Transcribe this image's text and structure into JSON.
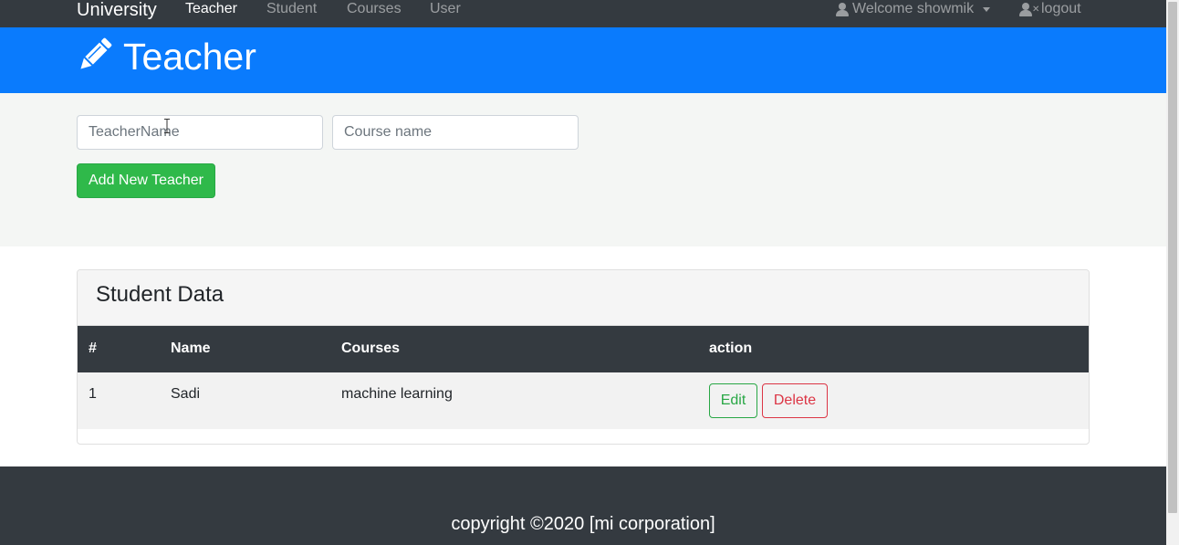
{
  "navbar": {
    "brand": "University",
    "links": [
      {
        "label": "Teacher",
        "active": true
      },
      {
        "label": "Student",
        "active": false
      },
      {
        "label": "Courses",
        "active": false
      },
      {
        "label": "User",
        "active": false
      }
    ],
    "welcome": "Welcome showmik",
    "logout": "logout"
  },
  "header": {
    "icon": "pencil-icon",
    "title": "Teacher"
  },
  "form": {
    "teacher_name_placeholder": "TeacherName",
    "course_name_placeholder": "Course name",
    "add_button": "Add New Teacher"
  },
  "table": {
    "title": "Student Data",
    "columns": [
      "#",
      "Name",
      "Courses",
      "action"
    ],
    "rows": [
      {
        "num": "1",
        "name": "Sadi",
        "course": "machine learning",
        "edit": "Edit",
        "delete": "Delete"
      }
    ]
  },
  "footer": {
    "text": "copyright ©2020 [mi corporation]"
  },
  "colors": {
    "navbar": "#343a40",
    "header": "#0a7bfd",
    "success": "#28a745",
    "danger": "#dc3545"
  }
}
